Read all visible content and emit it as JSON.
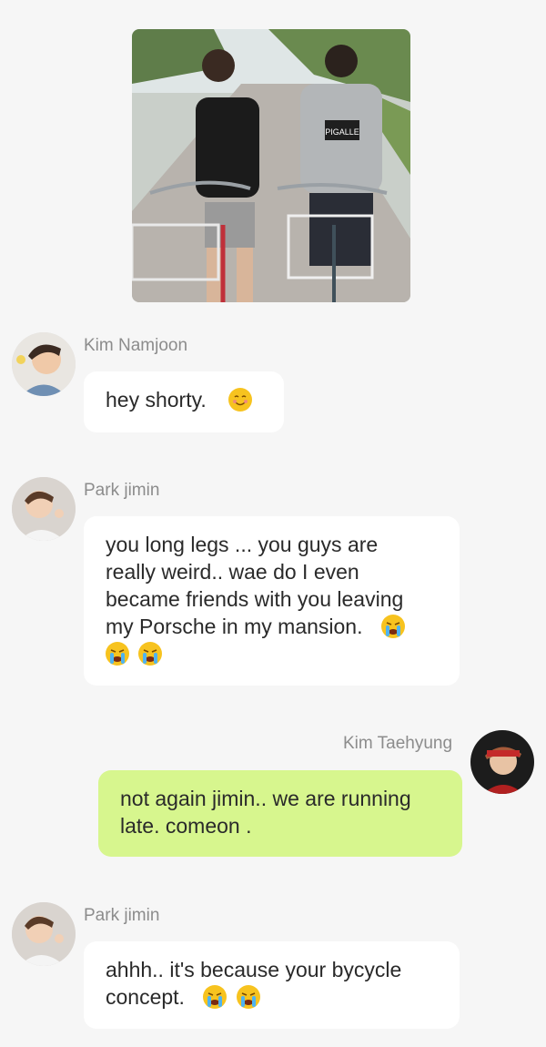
{
  "photo": {
    "icon": "photo-two-people-on-bicycles",
    "shirt_text": "PIGALLE"
  },
  "messages": [
    {
      "sender": "Kim Namjoon",
      "text": "hey shorty.",
      "emojis": [
        "smiling-face-icon"
      ]
    },
    {
      "sender": "Park jimin",
      "line1": "you long legs ... you guys are",
      "line2": "really weird.. wae do I even",
      "line3": "became friends with you leaving",
      "line4": "my Porsche in my mansion.",
      "emojis": [
        "crying-face-icon",
        "crying-face-icon",
        "crying-face-icon"
      ]
    },
    {
      "sender": "Kim Taehyung",
      "line1": "not again jimin.. we are running",
      "line2": "late.  comeon .",
      "own": true
    },
    {
      "sender": "Park jimin",
      "line1": "ahhh.. it's because your bycycle",
      "line2": "concept.",
      "emojis": [
        "crying-face-icon",
        "crying-face-icon"
      ]
    }
  ],
  "colors": {
    "background": "#f6f6f6",
    "incoming_bubble": "#ffffff",
    "outgoing_bubble": "#d7f68e",
    "sender_name": "#8c8c8c"
  }
}
